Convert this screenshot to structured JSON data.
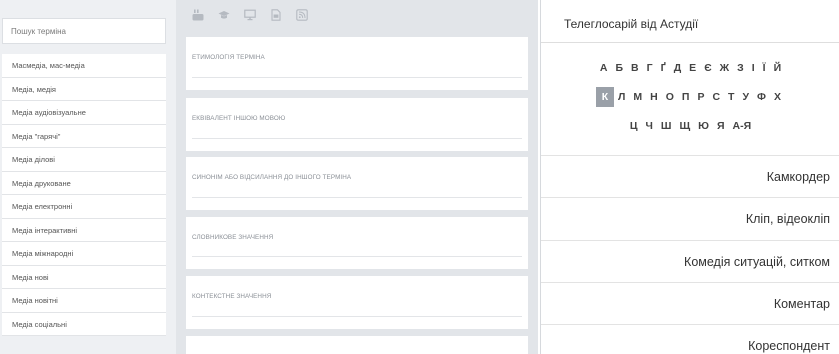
{
  "search": {
    "placeholder": "Пошук терміна"
  },
  "terms": [
    "Масмедіа, мас-медіа",
    "Медіа, медія",
    "Медіа аудіовізуальне",
    "Медіа \"гарячі\"",
    "Медіа ділові",
    "Медіа друковане",
    "Медіа електронні",
    "Медіа інтерактивні",
    "Медіа міжнародні",
    "Медіа нові",
    "Медіа новітні",
    "Медіа соціальні"
  ],
  "toolbar": {
    "icons": [
      "youtube-icon",
      "graduation-cap-icon",
      "monitor-icon",
      "document-icon",
      "rss-icon"
    ],
    "icon_color": "#b5bac1"
  },
  "fields": [
    "ЕТИМОЛОГІЯ ТЕРМІНА",
    "ЕКВІВАЛЕНТ ІНШОЮ МОВОЮ",
    "СИНОНІМ АБО ВІДСИЛАННЯ ДО ІНШОГО ТЕРМІНА",
    "СЛОВНИКОВЕ ЗНАЧЕННЯ",
    "КОНТЕКСТНЕ ЗНАЧЕННЯ"
  ],
  "glossary": {
    "title": "Телеглосарій від Астудії",
    "alphabet_rows": [
      [
        "А",
        "Б",
        "В",
        "Г",
        "Ґ",
        "Д",
        "Е",
        "Є",
        "Ж",
        "З",
        "І",
        "Ї",
        "Й"
      ],
      [
        "К",
        "Л",
        "М",
        "Н",
        "О",
        "П",
        "Р",
        "С",
        "Т",
        "У",
        "Ф",
        "Х"
      ],
      [
        "Ц",
        "Ч",
        "Ш",
        "Щ",
        "Ю",
        "Я",
        "А-Я"
      ]
    ],
    "active_letter": "К",
    "active_color": "#9aa0a8",
    "entries": [
      "Камкордер",
      "Кліп, відеокліп",
      "Комедія ситуацій, ситком",
      "Коментар",
      "Кореспондент"
    ]
  }
}
